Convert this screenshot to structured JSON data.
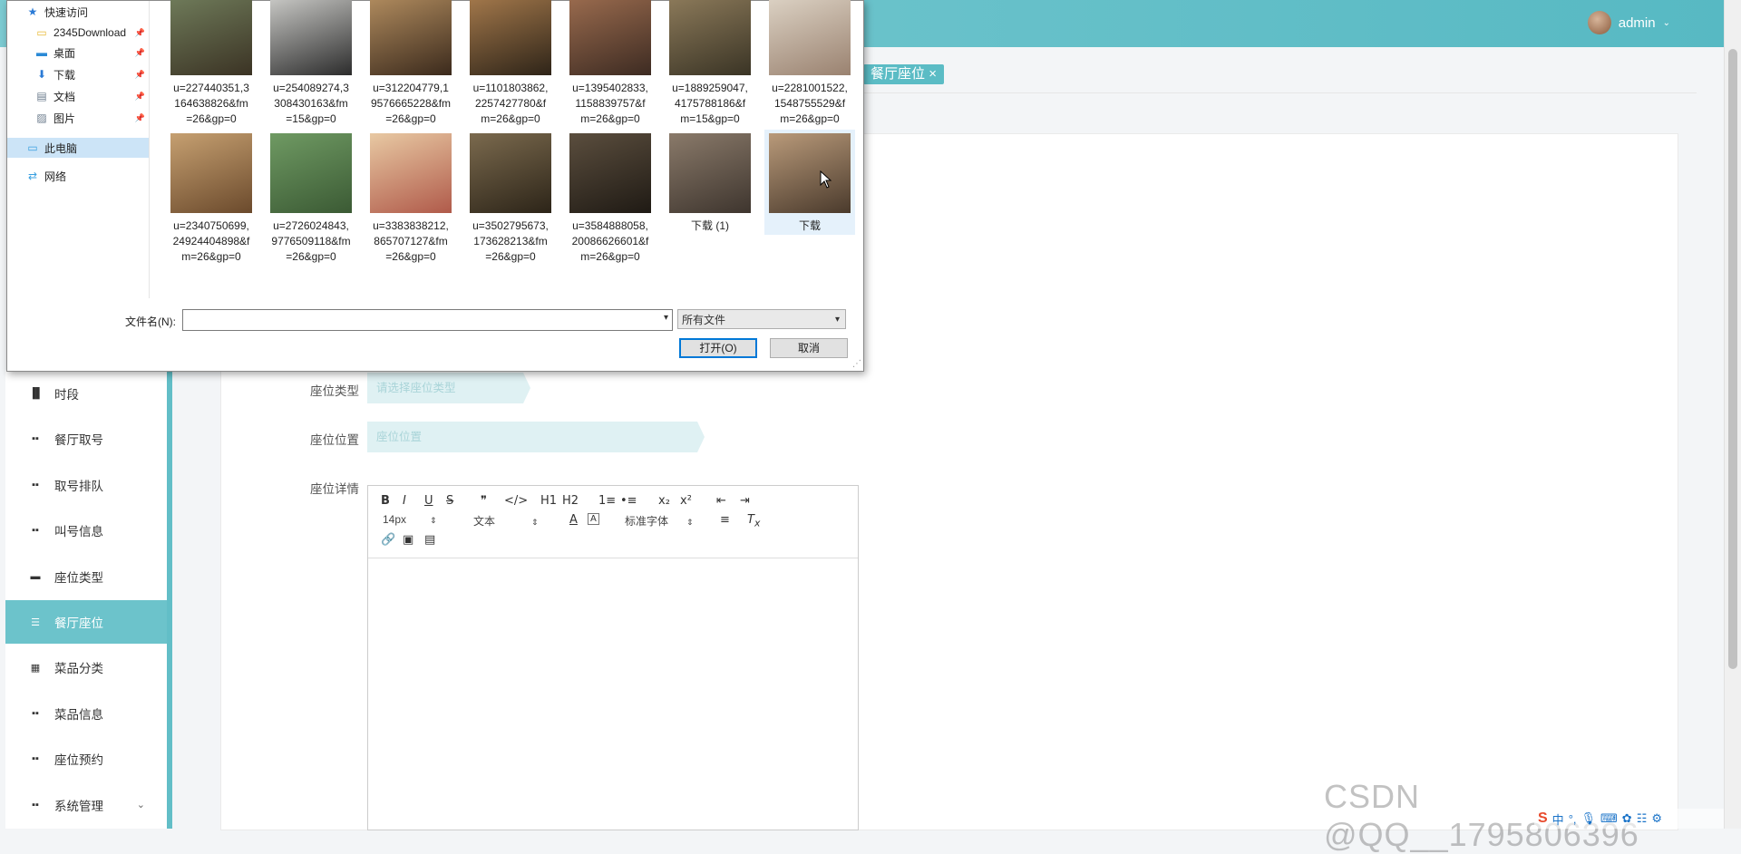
{
  "header": {
    "username": "admin"
  },
  "tabs": [
    {
      "label": "餐厅座位",
      "close": "×"
    }
  ],
  "sidebar": {
    "items": [
      {
        "label": "时段",
        "icon": "bar-chart-icon"
      },
      {
        "label": "餐厅取号",
        "icon": "grid-icon"
      },
      {
        "label": "取号排队",
        "icon": "grid-icon"
      },
      {
        "label": "叫号信息",
        "icon": "grid-icon"
      },
      {
        "label": "座位类型",
        "icon": "comment-icon"
      },
      {
        "label": "餐厅座位",
        "icon": "sliders-icon",
        "active": true
      },
      {
        "label": "菜品分类",
        "icon": "apps-icon"
      },
      {
        "label": "菜品信息",
        "icon": "grid-icon"
      },
      {
        "label": "座位预约",
        "icon": "grid-icon"
      },
      {
        "label": "系统管理",
        "icon": "grid-icon",
        "expandable": true
      }
    ]
  },
  "form": {
    "seat_type_label": "座位类型",
    "seat_type_placeholder": "请选择座位类型",
    "seat_location_label": "座位位置",
    "seat_location_placeholder": "座位位置",
    "seat_detail_label": "座位详情"
  },
  "editor": {
    "toolbar_row1": [
      "B",
      "I",
      "U",
      "S",
      "❞",
      "</>",
      "H1",
      "H2",
      "1≡",
      "•≡",
      "x₂",
      "x²",
      "⇤",
      "⇥"
    ],
    "font_size": "14px",
    "block_format": "文本",
    "font_family": "标准字体"
  },
  "dialog": {
    "nav": [
      {
        "label": "快速访问",
        "icon": "star-icon"
      },
      {
        "label": "2345Download",
        "icon": "folder-icon",
        "pinned": true
      },
      {
        "label": "桌面",
        "icon": "desktop-icon",
        "pinned": true
      },
      {
        "label": "下载",
        "icon": "download-icon",
        "pinned": true
      },
      {
        "label": "文档",
        "icon": "document-icon",
        "pinned": true
      },
      {
        "label": "图片",
        "icon": "picture-icon",
        "pinned": true
      },
      {
        "label": "此电脑",
        "icon": "computer-icon",
        "selected": true
      },
      {
        "label": "网络",
        "icon": "network-icon"
      }
    ],
    "files_row1": [
      {
        "lines": [
          "u=227440351,3",
          "164638826&fm",
          "=26&gp=0"
        ],
        "colors": [
          "#6f7b5a",
          "#3b3324"
        ]
      },
      {
        "lines": [
          "u=254089274,3",
          "308430163&fm",
          "=15&gp=0"
        ],
        "colors": [
          "#c9c9c6",
          "#2c2c2c"
        ]
      },
      {
        "lines": [
          "u=312204779,1",
          "9576665228&fm",
          "=26&gp=0"
        ],
        "colors": [
          "#b08b5e",
          "#3b2a1c"
        ]
      },
      {
        "lines": [
          "u=1101803862,",
          "2257427780&f",
          "m=26&gp=0"
        ],
        "colors": [
          "#a3784b",
          "#2e2418"
        ]
      },
      {
        "lines": [
          "u=1395402833,",
          "1158839757&f",
          "m=26&gp=0"
        ],
        "colors": [
          "#9a6b4e",
          "#3d2b22"
        ]
      },
      {
        "lines": [
          "u=1889259047,",
          "4175788186&f",
          "m=15&gp=0"
        ],
        "colors": [
          "#8c7a5a",
          "#3a3425"
        ]
      },
      {
        "lines": [
          "u=2281001522,",
          "1548755529&f",
          "m=26&gp=0"
        ],
        "colors": [
          "#dcd2c4",
          "#9a8270"
        ]
      }
    ],
    "files_row2": [
      {
        "lines": [
          "u=2340750699,",
          "24924404898&f",
          "m=26&gp=0"
        ],
        "colors": [
          "#c6a071",
          "#6b4a2c"
        ]
      },
      {
        "lines": [
          "u=2726024843,",
          "9776509118&fm",
          "=26&gp=0"
        ],
        "colors": [
          "#6f9a63",
          "#3b5a34"
        ]
      },
      {
        "lines": [
          "u=3383838212,",
          "865707127&fm",
          "=26&gp=0"
        ],
        "colors": [
          "#e8c9a3",
          "#b05a4a"
        ]
      },
      {
        "lines": [
          "u=3502795673,",
          "173628213&fm",
          "=26&gp=0"
        ],
        "colors": [
          "#7b6a4e",
          "#2c2418"
        ]
      },
      {
        "lines": [
          "u=3584888058,",
          "20086626601&f",
          "m=26&gp=0"
        ],
        "colors": [
          "#5b4e3e",
          "#1f1a14"
        ]
      },
      {
        "lines": [
          "下载 (1)"
        ],
        "colors": [
          "#8a7a6a",
          "#3e352e"
        ]
      },
      {
        "lines": [
          "下载"
        ],
        "colors": [
          "#b99a7a",
          "#4a3a2c"
        ],
        "selected": true
      }
    ],
    "filename_label": "文件名(N):",
    "filename_value": "",
    "filter_value": "所有文件",
    "open_button": "打开(O)",
    "cancel_button": "取消"
  },
  "watermark": "CSDN @QQ__1795806396",
  "tray": {
    "ime": "中"
  }
}
